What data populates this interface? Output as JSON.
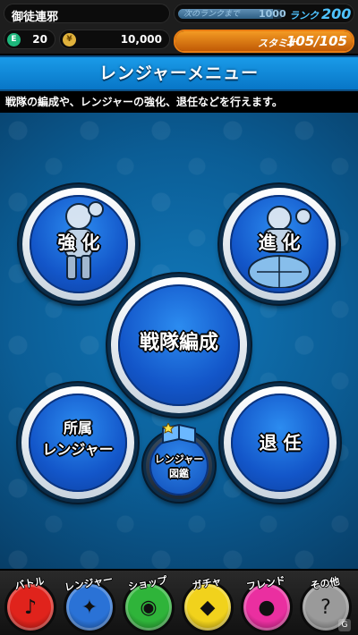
{
  "player": {
    "name": "御徒連邪",
    "exp_label": "次のランクまで",
    "exp_value": "1000",
    "exp_progress": 0.9,
    "rank_label": "ランク",
    "rank": "200",
    "gems": "20",
    "coins": "10,000",
    "stamina_label": "スタミナ",
    "stamina": "105/105",
    "stamina_progress": 1.0,
    "gem_icon": "E",
    "coin_icon": "¥"
  },
  "menu": {
    "title": "レンジャーメニュー",
    "description": "戦隊の編成や、レンジャーの強化、退任などを行えます。"
  },
  "buttons": {
    "strengthen": "強 化",
    "evolve": "進 化",
    "team_formation": "戦隊編成",
    "owned_rangers_line1": "所属",
    "owned_rangers_line2": "レンジャー",
    "dismiss": "退 任",
    "ranger_book_line1": "レンジャー",
    "ranger_book_line2": "図鑑"
  },
  "nav": [
    {
      "label": "バトル",
      "color": "#e0231c",
      "icon": "♪"
    },
    {
      "label": "レンジャー",
      "color": "#2a72d6",
      "icon": "✦"
    },
    {
      "label": "ショップ",
      "color": "#2fb43a",
      "icon": "◉"
    },
    {
      "label": "ガチャ",
      "color": "#f1d21c",
      "icon": "◆"
    },
    {
      "label": "フレンド",
      "color": "#ea2fa0",
      "icon": "●"
    },
    {
      "label": "その他",
      "color": "#9a9a9a",
      "icon": "?"
    }
  ],
  "watermark": "G"
}
